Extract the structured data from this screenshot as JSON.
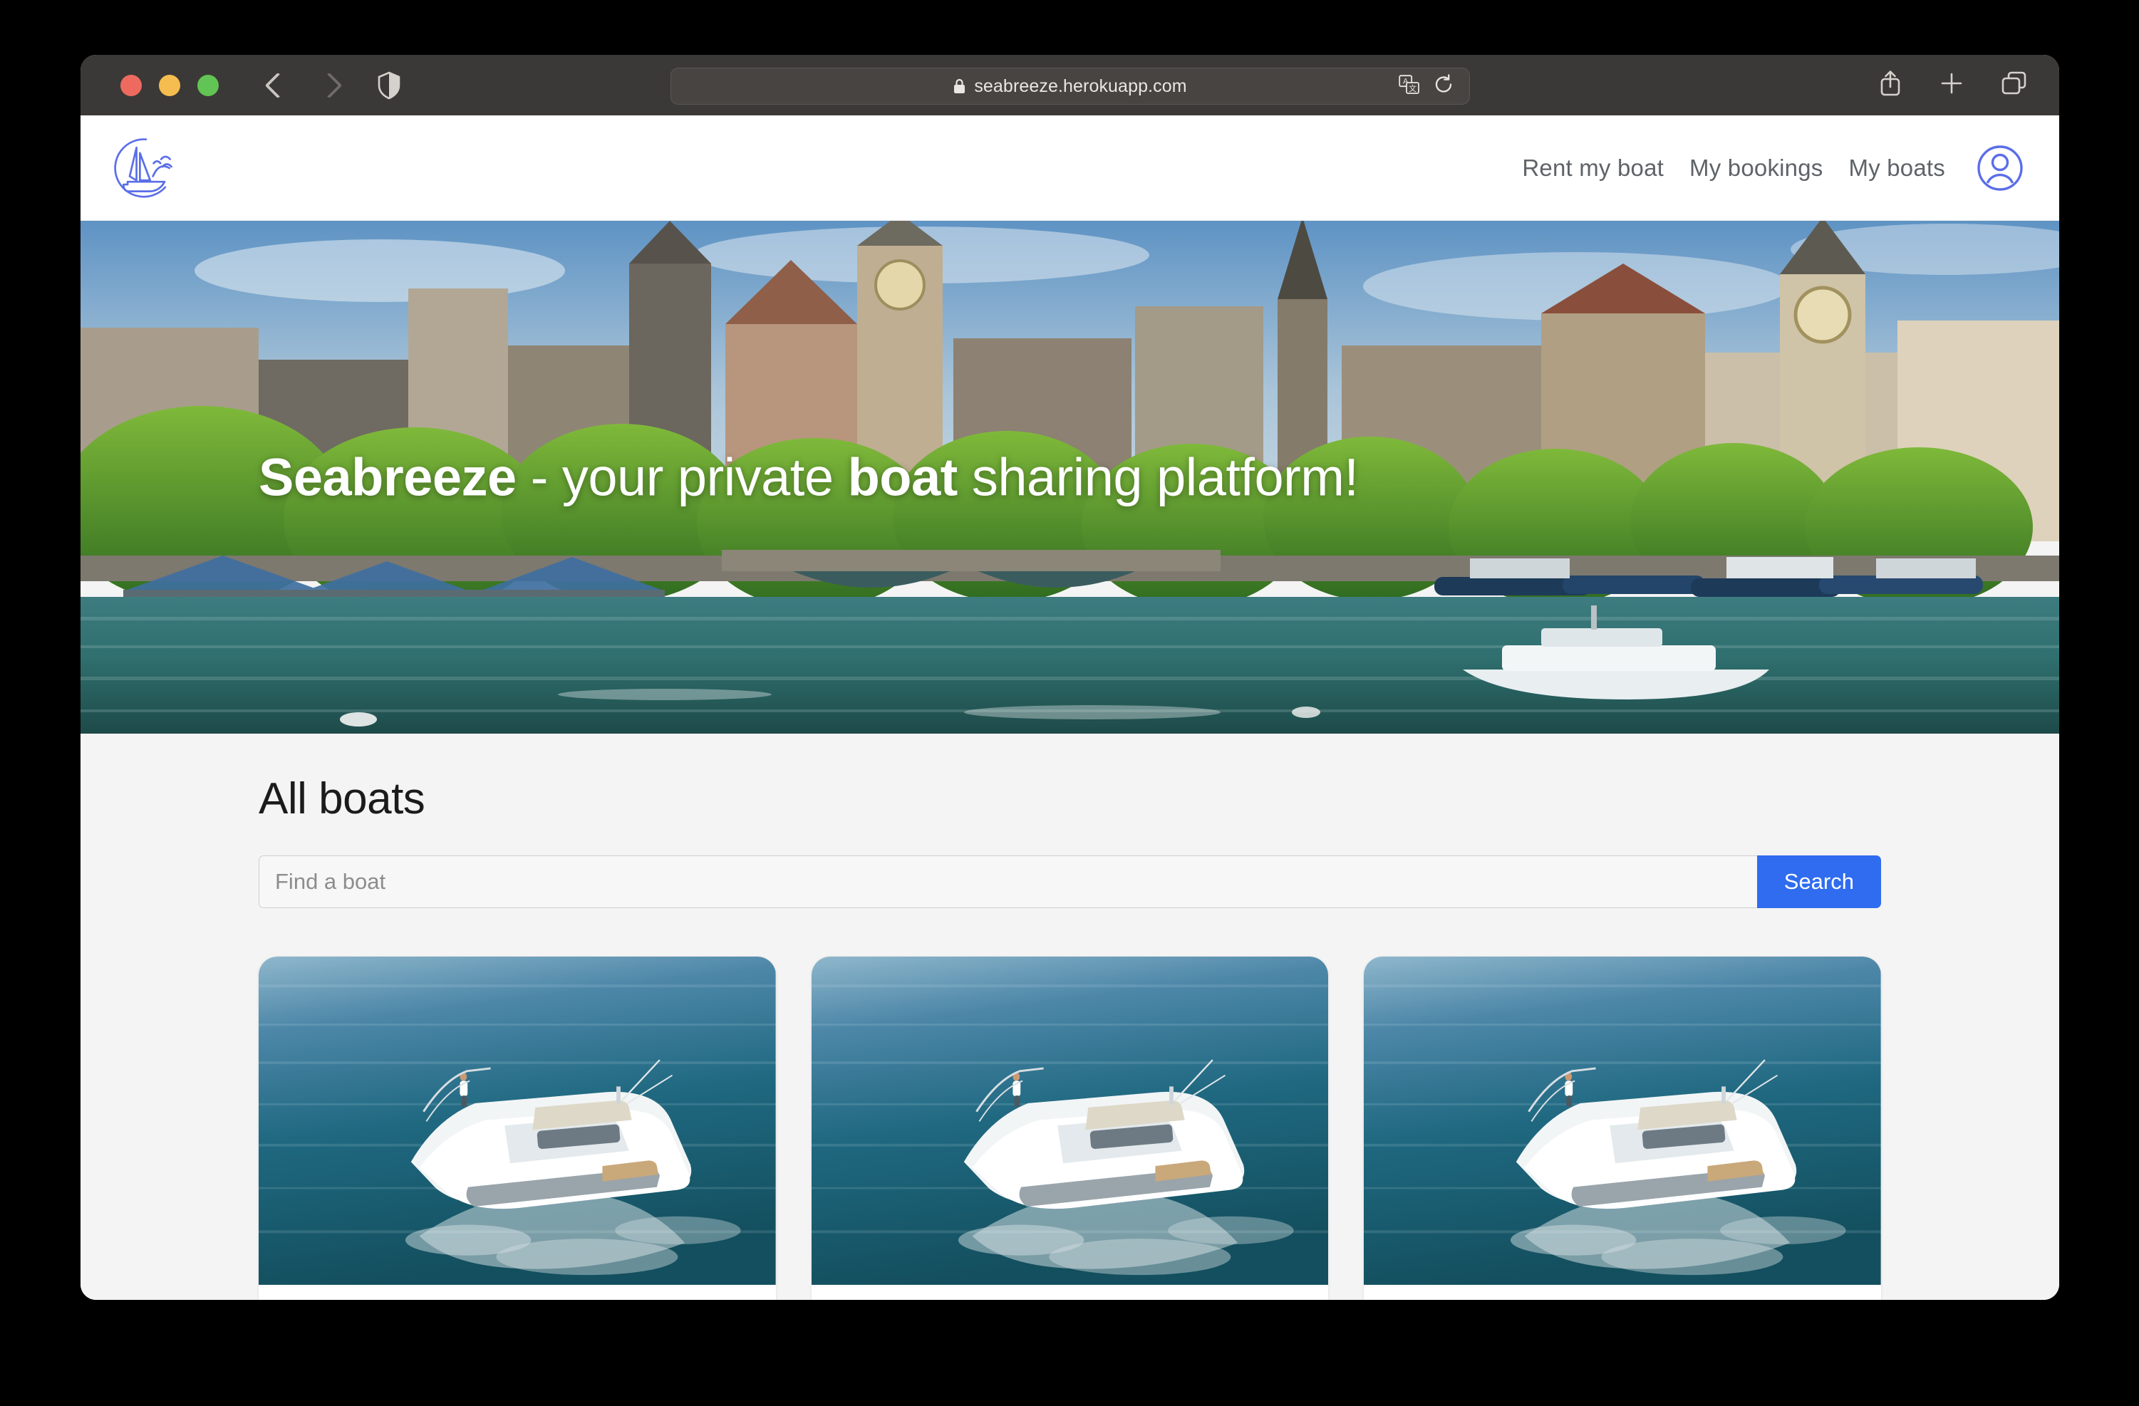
{
  "browser": {
    "traffic_lights": [
      "close",
      "minimize",
      "maximize"
    ],
    "back_label": "Back",
    "forward_label": "Forward",
    "shield_label": "Privacy Report",
    "url": "seabreeze.herokuapp.com",
    "lock_icon": "lock-icon",
    "translate_icon": "translate-icon",
    "reload_icon": "reload-icon",
    "share_icon": "share-icon",
    "new_tab_icon": "plus-icon",
    "tab_overview_icon": "tab-overview-icon"
  },
  "site": {
    "logo_icon": "sailboat-logo-icon",
    "nav": [
      {
        "label": "Rent my boat"
      },
      {
        "label": "My bookings"
      },
      {
        "label": "My boats"
      }
    ],
    "avatar_icon": "user-avatar-icon",
    "accent_color": "#5a6ee8",
    "button_color": "#2f6cef"
  },
  "hero": {
    "title_part1": "Seabreeze",
    "title_part2": " - your private ",
    "title_part3": "boat",
    "title_part4": " sharing platform!",
    "image_alt": "Zurich riverside cityscape with churches and moored boats"
  },
  "main": {
    "section_title": "All boats",
    "search": {
      "placeholder": "Find a boat",
      "value": "",
      "button_label": "Search"
    },
    "cards": [
      {
        "image_alt": "White motor yacht cruising on blue sea"
      },
      {
        "image_alt": "White motor yacht cruising on blue sea"
      },
      {
        "image_alt": "White motor yacht cruising on blue sea"
      }
    ]
  }
}
